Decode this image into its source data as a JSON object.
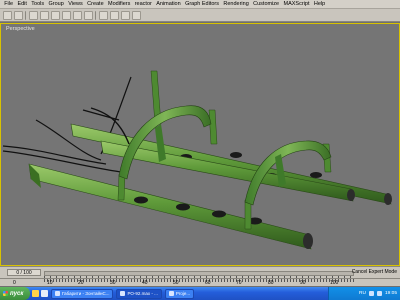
{
  "menu": [
    "File",
    "Edit",
    "Tools",
    "Group",
    "Views",
    "Create",
    "Modifiers",
    "reactor",
    "Animation",
    "Graph Editors",
    "Rendering",
    "Customize",
    "MAXScript",
    "Help"
  ],
  "viewport": {
    "label": "Perspective"
  },
  "timeline": {
    "slider_value": "0 / 100",
    "status": "Cancel Expert Mode"
  },
  "ruler": [
    "0",
    "10",
    "20",
    "30",
    "40",
    "50",
    "60",
    "70",
    "80",
    "90",
    "100"
  ],
  "taskbar": {
    "start_label": "пуск",
    "tasks": [
      "Габарити - ЗонтайнС...",
      "РО-92.max - ...",
      "Proje..."
    ],
    "tray": {
      "language": "RU",
      "clock": "19:05"
    }
  },
  "colors": {
    "viewport_bg": "#757575",
    "active_border": "#d8c200",
    "pipe_green": "#5f9a3a"
  }
}
